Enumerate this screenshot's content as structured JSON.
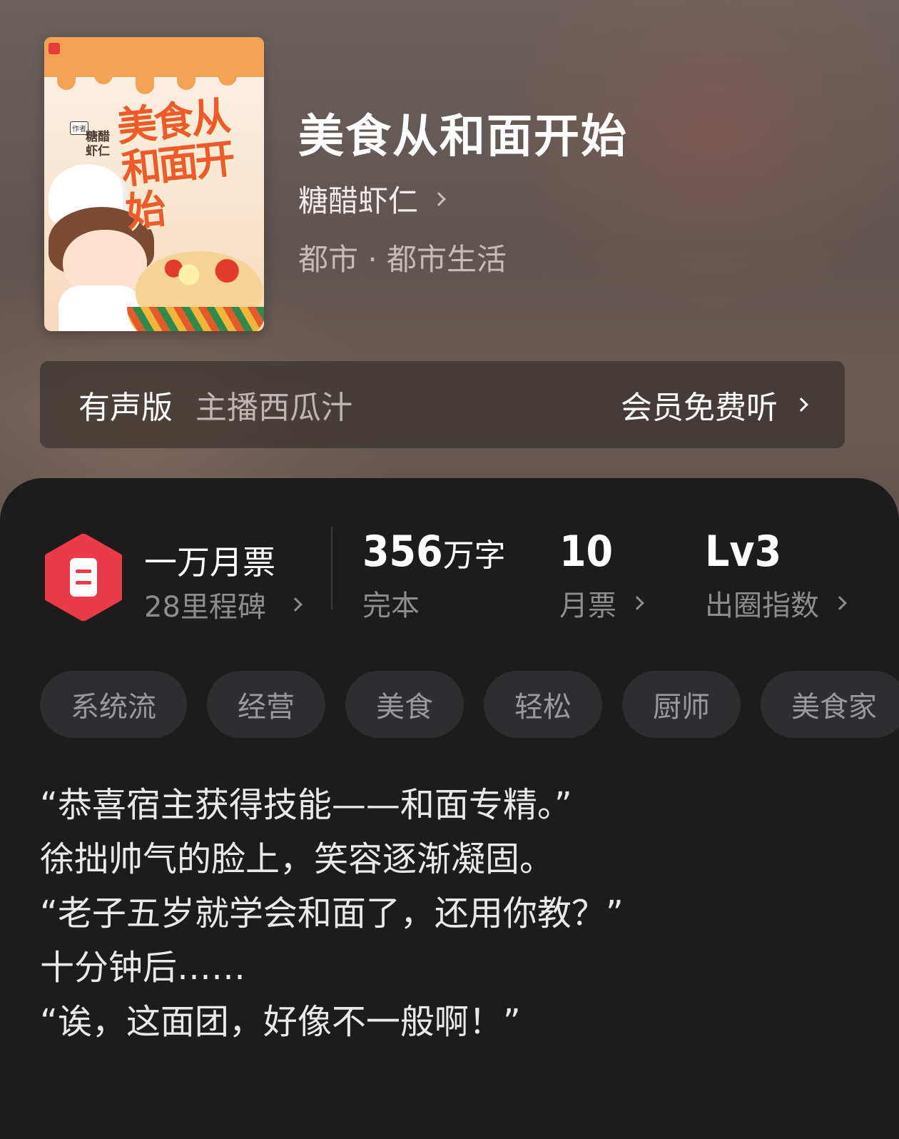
{
  "book": {
    "title": "美食从和面开始",
    "author": "糖醋虾仁",
    "category": "都市 · 都市生活"
  },
  "cover": {
    "title_art": "美食从和面开始",
    "author_art": "糖醋虾仁",
    "tag_art": "作者",
    "colors": {
      "accent": "#ef5a2c",
      "drip": "#f2a356"
    }
  },
  "audio": {
    "label": "有声版",
    "narrator": "主播西瓜汁",
    "action": "会员免费听"
  },
  "stats": {
    "ticket": {
      "title": "一万月票",
      "subtitle": "28里程碑"
    },
    "words": {
      "value": "356",
      "unit": "万字",
      "label": "完本"
    },
    "monthly_votes": {
      "value": "10",
      "label": "月票"
    },
    "popularity": {
      "value": "Lv3",
      "label": "出圈指数"
    }
  },
  "tags": [
    "系统流",
    "经营",
    "美食",
    "轻松",
    "厨师",
    "美食家"
  ],
  "synopsis": [
    "“恭喜宿主获得技能——和面专精。”",
    "徐拙帅气的脸上，笑容逐渐凝固。",
    "“老子五岁就学会和面了，还用你教？”",
    "十分钟后……",
    "“诶，这面团，好像不一般啊！”"
  ],
  "colors": {
    "ticket_icon": "#ec3b48",
    "sheet_bg": "#1c1c1d",
    "tag_bg": "#2e2e30"
  }
}
